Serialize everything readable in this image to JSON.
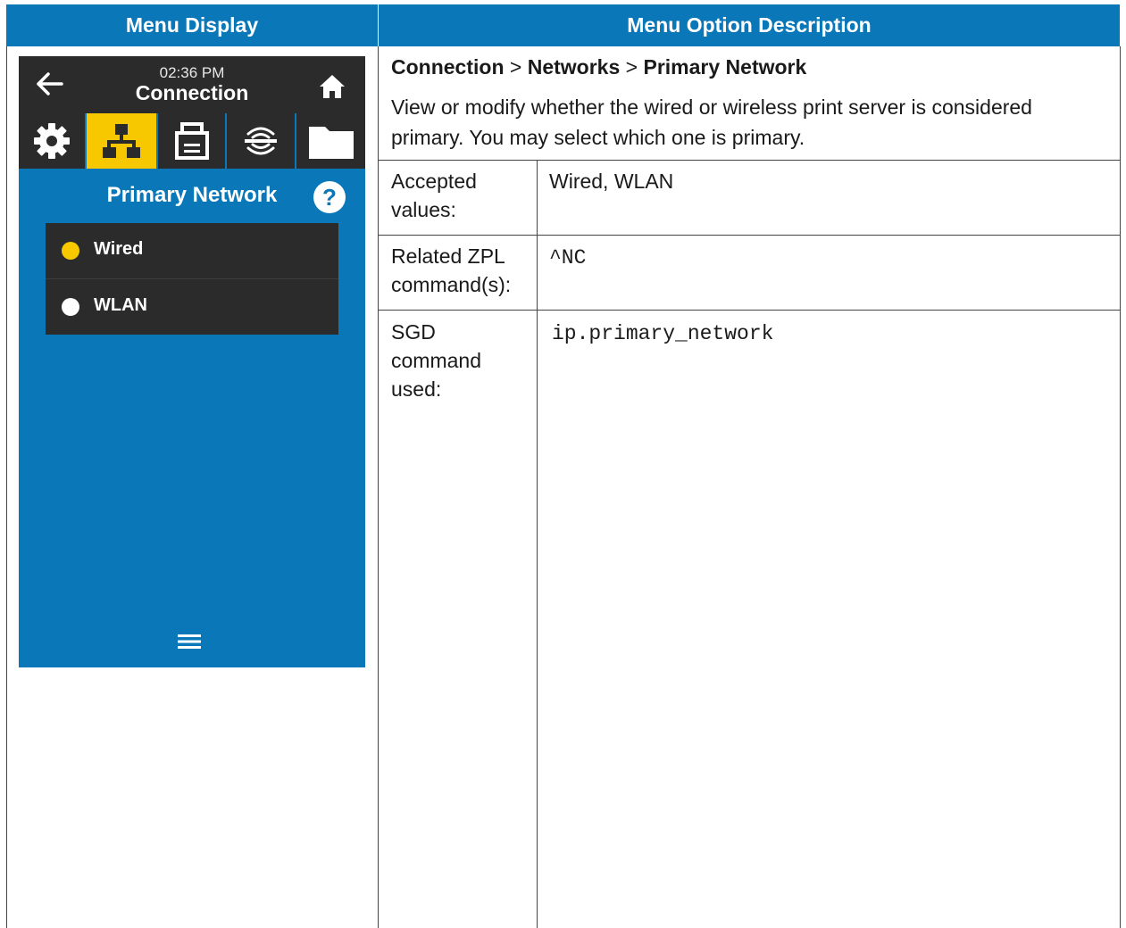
{
  "table": {
    "col_left_header": "Menu Display",
    "col_right_header": "Menu Option Description"
  },
  "screen": {
    "time": "02:36 PM",
    "title": "Connection",
    "tabs": [
      {
        "icon": "gear-icon",
        "active": false
      },
      {
        "icon": "network-icon",
        "active": true
      },
      {
        "icon": "printer-icon",
        "active": false
      },
      {
        "icon": "wireless-icon",
        "active": false
      },
      {
        "icon": "folder-icon",
        "active": false
      }
    ],
    "page_title": "Primary Network",
    "help_label": "?",
    "options": [
      {
        "label": "Wired",
        "selected": true
      },
      {
        "label": "WLAN",
        "selected": false
      }
    ],
    "colors": {
      "background": "#0a77b8",
      "bar": "#2b2b2b",
      "accent": "#f7c700"
    }
  },
  "breadcrumb": {
    "level1": "Connection",
    "sep1": " > ",
    "level2": "Networks",
    "sep2": " > ",
    "level3": "Primary Network"
  },
  "description": "View or modify whether the wired or wireless print server is considered primary. You may select which one is primary.",
  "rows": [
    {
      "label": "Accepted values:",
      "value": "Wired, WLAN"
    },
    {
      "label": "Related ZPL command(s):",
      "value": "^NC"
    },
    {
      "label": "SGD command used:",
      "value": "ip.primary_network"
    }
  ]
}
